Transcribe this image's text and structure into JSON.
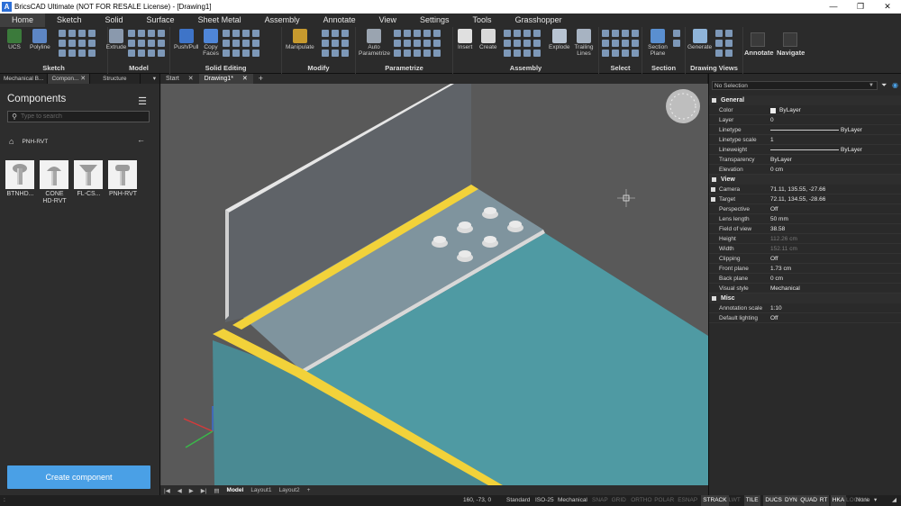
{
  "window": {
    "title": "BricsCAD Ultimate (NOT FOR RESALE License) - [Drawing1]",
    "minimize": "—",
    "restore": "❐",
    "close": "✕",
    "app_icon": "A"
  },
  "menu": {
    "tabs": [
      "Home",
      "Sketch",
      "Solid",
      "Surface",
      "Sheet Metal",
      "Assembly",
      "Annotate",
      "View",
      "Settings",
      "Tools",
      "Grasshopper"
    ]
  },
  "ribbon": {
    "groups": {
      "sketch": "Sketch",
      "model": "Model",
      "solid_editing": "Solid Editing",
      "modify": "Modify",
      "parametrize": "Parametrize",
      "assembly": "Assembly",
      "select": "Select",
      "section": "Section",
      "drawing_views": "Drawing Views"
    },
    "buttons": {
      "ucs": "UCS",
      "polyline": "Polyline",
      "extrude": "Extrude",
      "push_pull": "Push/Pull",
      "copy_faces": "Copy Faces",
      "manipulate": "Manipulate",
      "auto_parametrize": "Auto Parametrize",
      "insert": "Insert",
      "create": "Create",
      "explode": "Explode",
      "trailing_lines": "Trailing Lines",
      "section_plane": "Section Plane",
      "generate": "Generate",
      "annotate": "Annotate",
      "navigate": "Navigate"
    }
  },
  "panel": {
    "tabs": [
      "Mechanical B...",
      "Compon...",
      "Structure"
    ],
    "title": "Components",
    "search_placeholder": "Type to search",
    "breadcrumb": "PNH-RVT",
    "items": [
      "BTNHD...",
      "CONE HD-RVT",
      "FL-CS...",
      "PNH-RVT"
    ],
    "create_button": "Create component"
  },
  "doc_tabs": [
    "Start",
    "Drawing1*"
  ],
  "layout_tabs": [
    "Model",
    "Layout1",
    "Layout2"
  ],
  "properties": {
    "selection": "No Selection",
    "general_label": "General",
    "general": [
      {
        "name": "Color",
        "value": "ByLayer"
      },
      {
        "name": "Layer",
        "value": "0"
      },
      {
        "name": "Linetype",
        "value": "ByLayer"
      },
      {
        "name": "Linetype scale",
        "value": "1"
      },
      {
        "name": "Lineweight",
        "value": "ByLayer"
      },
      {
        "name": "Transparency",
        "value": "ByLayer"
      },
      {
        "name": "Elevation",
        "value": "0 cm"
      }
    ],
    "view_label": "View",
    "view": [
      {
        "name": "Camera",
        "value": "71.11, 135.55, -27.66"
      },
      {
        "name": "Target",
        "value": "72.11, 134.55, -28.66"
      },
      {
        "name": "Perspective",
        "value": "Off"
      },
      {
        "name": "Lens length",
        "value": "50 mm"
      },
      {
        "name": "Field of view",
        "value": "38.58"
      },
      {
        "name": "Height",
        "value": "112.26 cm"
      },
      {
        "name": "Width",
        "value": "152.11 cm"
      },
      {
        "name": "Clipping",
        "value": "Off"
      },
      {
        "name": "Front plane",
        "value": "1.73 cm"
      },
      {
        "name": "Back plane",
        "value": "0 cm"
      },
      {
        "name": "Visual style",
        "value": "Mechanical"
      }
    ],
    "misc_label": "Misc",
    "misc": [
      {
        "name": "Annotation scale",
        "value": "1:10"
      },
      {
        "name": "Default lighting",
        "value": "Off"
      }
    ]
  },
  "status": {
    "coords": "160, -73, 0",
    "style": "Standard",
    "dimstyle": "ISO-25",
    "visual": "Mechanical",
    "toggles": [
      "SNAP",
      "GRID",
      "ORTHO",
      "POLAR",
      "ESNAP",
      "STRACK",
      "LWT",
      "TILE",
      "DUCS",
      "DYN",
      "QUAD",
      "RT",
      "HKA",
      "LOCKUI"
    ],
    "toggle_states": [
      false,
      false,
      false,
      false,
      false,
      true,
      false,
      true,
      true,
      true,
      true,
      true,
      true,
      false
    ],
    "none": "None"
  },
  "colors": {
    "accent": "#4aa0e6",
    "highlight_edge": "#f2d23a",
    "sheet_face": "#4f9aa3",
    "plate_face": "#7f949e",
    "wall_face": "#5e6266"
  }
}
